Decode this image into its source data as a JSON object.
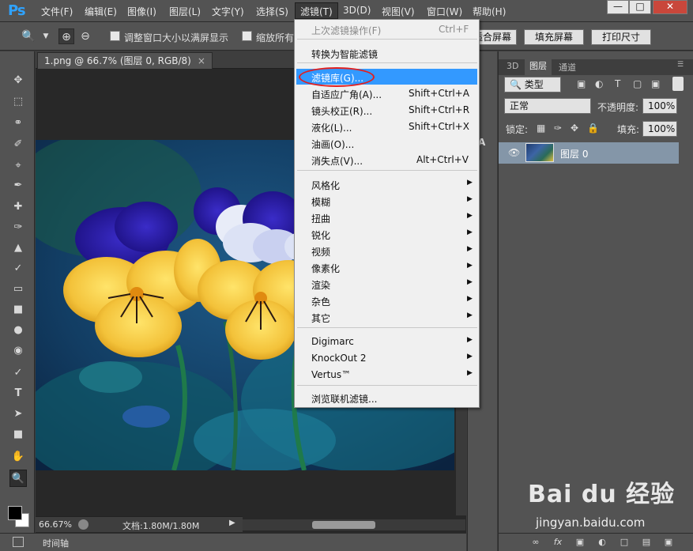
{
  "app": {
    "logo": "Ps",
    "menus": [
      "文件(F)",
      "编辑(E)",
      "图像(I)",
      "图层(L)",
      "文字(Y)",
      "选择(S)",
      "滤镜(T)",
      "3D(D)",
      "视图(V)",
      "窗口(W)",
      "帮助(H)"
    ],
    "window_buttons": {
      "minimize": "—",
      "maximize": "□",
      "close": "✕"
    }
  },
  "options": {
    "resize_windows_label": "调整窗口大小以满屏显示",
    "zoom_all_label": "缩放所有",
    "fit_screen_label": "适合屏幕",
    "fill_screen_label": "填充屏幕",
    "print_size_label": "打印尺寸"
  },
  "document": {
    "tab_title": "1.png @ 66.7% (图层 0, RGB/8)",
    "tab_close": "×",
    "zoom": "66.67%",
    "doc_info": "文档:1.80M/1.80M",
    "timeline_label": "时间轴"
  },
  "filter_menu": {
    "items": [
      {
        "label": "上次滤镜操作(F)",
        "shortcut": "Ctrl+F",
        "disabled": true
      },
      {
        "label": "转换为智能滤镜"
      },
      {
        "label": "滤镜库(G)...",
        "highlighted": true
      },
      {
        "label": "自适应广角(A)...",
        "shortcut": "Shift+Ctrl+A"
      },
      {
        "label": "镜头校正(R)...",
        "shortcut": "Shift+Ctrl+R"
      },
      {
        "label": "液化(L)...",
        "shortcut": "Shift+Ctrl+X"
      },
      {
        "label": "油画(O)..."
      },
      {
        "label": "消失点(V)...",
        "shortcut": "Alt+Ctrl+V"
      },
      {
        "label": "风格化",
        "submenu": true
      },
      {
        "label": "模糊",
        "submenu": true
      },
      {
        "label": "扭曲",
        "submenu": true
      },
      {
        "label": "锐化",
        "submenu": true
      },
      {
        "label": "视频",
        "submenu": true
      },
      {
        "label": "像素化",
        "submenu": true
      },
      {
        "label": "渲染",
        "submenu": true
      },
      {
        "label": "杂色",
        "submenu": true
      },
      {
        "label": "其它",
        "submenu": true
      },
      {
        "label": "Digimarc",
        "submenu": true
      },
      {
        "label": "KnockOut 2",
        "submenu": true
      },
      {
        "label": "Vertus™",
        "submenu": true
      },
      {
        "label": "浏览联机滤镜..."
      }
    ]
  },
  "layers_panel": {
    "tabs": [
      "3D",
      "图层",
      "通道"
    ],
    "filter_kind": "类型",
    "blend_mode": "正常",
    "opacity_label": "不透明度:",
    "opacity_value": "100%",
    "lock_label": "锁定:",
    "fill_label": "填充:",
    "fill_value": "100%",
    "layer_name": "图层 0"
  },
  "watermark": {
    "logo": "Bai du 经验",
    "url": "jingyan.baidu.com"
  },
  "colors": {
    "menu_highlight": "#3399ff",
    "annotation_red": "#e02020",
    "ps_blue": "#2fa3ff",
    "layer_selected": "#8496a8"
  }
}
